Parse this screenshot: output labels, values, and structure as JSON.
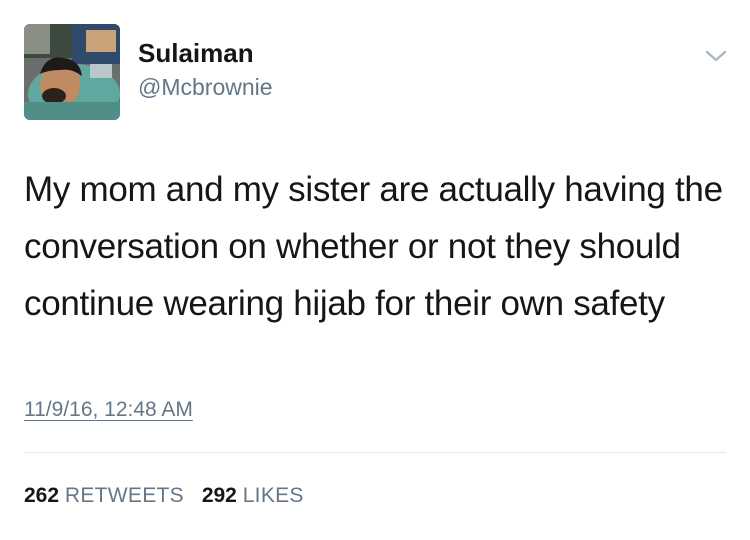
{
  "user": {
    "display_name": "Sulaiman",
    "handle": "@Mcbrownie"
  },
  "tweet": {
    "text": "My mom and my sister are actually having the conversation on whether or not they should continue wearing hijab for their own safety",
    "timestamp": "11/9/16, 12:48 AM"
  },
  "stats": {
    "retweets_count": "262",
    "retweets_label": "RETWEETS",
    "likes_count": "292",
    "likes_label": "LIKES"
  },
  "icons": {
    "menu": "chevron-down-icon",
    "avatar": "profile-photo"
  },
  "colors": {
    "text_primary": "#14171a",
    "text_secondary": "#657786",
    "divider": "#e1e8ed",
    "chevron": "#aab8c2"
  }
}
